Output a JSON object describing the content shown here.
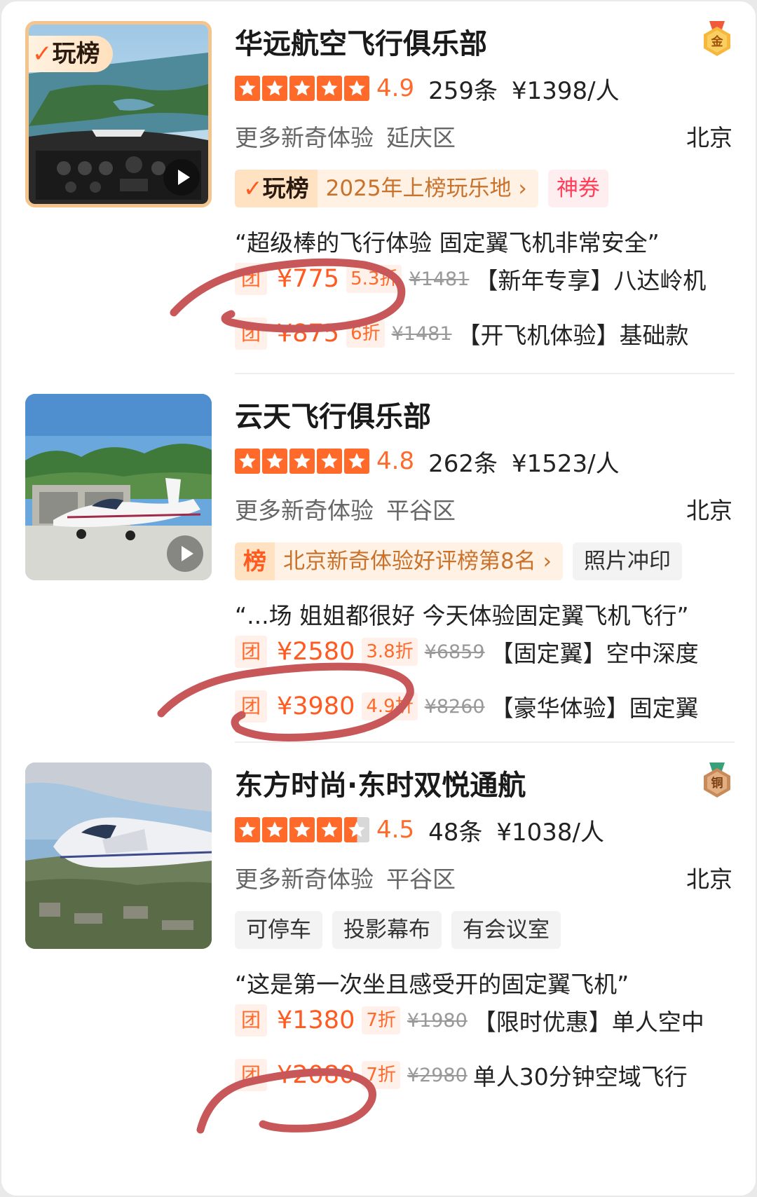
{
  "listings": [
    {
      "title": "华远航空飞行俱乐部",
      "medal": "金",
      "thumb_badge": "玩榜",
      "rating": "4.9",
      "stars": 5,
      "reviews": "259条",
      "price_per_person": "¥1398/人",
      "category": "更多新奇体验",
      "district": "延庆区",
      "city": "北京",
      "rank_tag_mark": "玩榜",
      "rank_tag_text": "2025年上榜玩乐地",
      "coupon_tag": "神券",
      "quote": "“超级棒的飞行体验 固定翼飞机非常安全”",
      "deals": [
        {
          "tuan": "团",
          "price": "¥775",
          "discount": "5.3折",
          "original": "¥1481",
          "title": "【新年专享】八达岭机"
        },
        {
          "tuan": "团",
          "price": "¥875",
          "discount": "6折",
          "original": "¥1481",
          "title": "【开飞机体验】基础款"
        }
      ]
    },
    {
      "title": "云天飞行俱乐部",
      "rating": "4.8",
      "stars": 5,
      "reviews": "262条",
      "price_per_person": "¥1523/人",
      "category": "更多新奇体验",
      "district": "平谷区",
      "city": "北京",
      "rank_tag_mark": "榜",
      "rank_tag_text": "北京新奇体验好评榜第8名",
      "plain_tag": "照片冲印",
      "quote": "“...场 姐姐都很好 今天体验固定翼飞机飞行”",
      "deals": [
        {
          "tuan": "团",
          "price": "¥2580",
          "discount": "3.8折",
          "original": "¥6859",
          "title": "【固定翼】空中深度"
        },
        {
          "tuan": "团",
          "price": "¥3980",
          "discount": "4.9折",
          "original": "¥8260",
          "title": "【豪华体验】固定翼"
        }
      ]
    },
    {
      "title": "东方时尚·东时双悦通航",
      "medal": "铜",
      "rating": "4.5",
      "stars": 4.5,
      "reviews": "48条",
      "price_per_person": "¥1038/人",
      "category": "更多新奇体验",
      "district": "平谷区",
      "city": "北京",
      "tags": [
        "可停车",
        "投影幕布",
        "有会议室"
      ],
      "quote": "“这是第一次坐且感受开的固定翼飞机”",
      "deals": [
        {
          "tuan": "团",
          "price": "¥1380",
          "discount": "7折",
          "original": "¥1980",
          "title": "【限时优惠】单人空中"
        },
        {
          "tuan": "团",
          "price": "¥2080",
          "discount": "7折",
          "original": "¥2980",
          "title": "单人30分钟空域飞行"
        }
      ]
    }
  ],
  "colors": {
    "accent": "#ff6a2a",
    "price": "#ff5a1f",
    "rank_text": "#c9722c",
    "coupon": "#ff3f5a",
    "annotation": "#c8575a"
  },
  "icons": [
    "star-icon",
    "play-icon",
    "gold-medal-icon",
    "bronze-medal-icon"
  ]
}
